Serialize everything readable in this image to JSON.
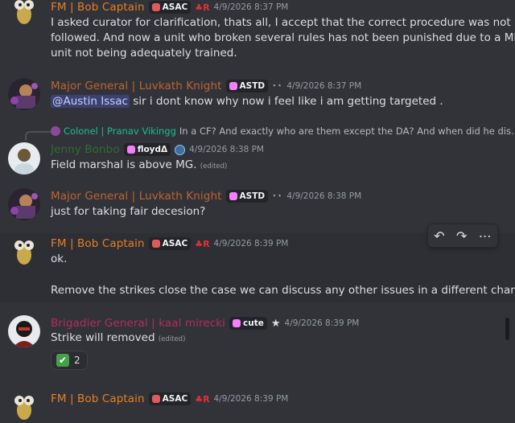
{
  "messages": [
    {
      "name": "FM | Bob Captain",
      "name_color": "#e67e22",
      "tag": "ASAC",
      "badge": "♣R",
      "timestamp": "4/9/2026 8:37 PM",
      "lines": [
        "I asked curator for clarification, thats all, I accept that the correct procedure was not",
        "followed. And now a unit who broken several rules has not been punished due to a MP",
        "unit not being adequately trained."
      ]
    },
    {
      "name": "Major General | Luvkath  Knight",
      "name_color": "#c0632f",
      "tag": "ASTD",
      "stars": "⋆⋆",
      "timestamp": "4/9/2026 8:37 PM",
      "mention": "@Austin Issac",
      "text": " sir i dont know why now i feel like i am getting  targeted ."
    },
    {
      "reply_name": "Colonel | Pranav Vikingg",
      "reply_text": "In a CF? And exactly who are them except the DA? And when did he dis...",
      "name": "Jenny Bonbo",
      "name_color": "#2d6e2d",
      "tag": "floydΔ",
      "timestamp": "4/9/2026 8:38 PM",
      "text": "Field marshal is above MG.",
      "edited": "(edited)"
    },
    {
      "name": "Major General | Luvkath  Knight",
      "name_color": "#c0632f",
      "tag": "ASTD",
      "stars": "⋆⋆",
      "timestamp": "4/9/2026 8:38 PM",
      "text": "just for taking fair decesion?"
    },
    {
      "name": "FM | Bob Captain",
      "name_color": "#e67e22",
      "tag": "ASAC",
      "badge": "♣R",
      "timestamp": "4/9/2026 8:39 PM",
      "line1": "ok.",
      "line2": "Remove the strikes close the case we can discuss any other issues in a different channel"
    },
    {
      "name": "Brigadier General | kaal mirecki",
      "name_color": "#b02e5a",
      "tag": "cute",
      "timestamp": "4/9/2026 8:39 PM",
      "text": "Strike will removed",
      "edited": "(edited)",
      "reaction_emoji": "✔",
      "reaction_count": "2"
    },
    {
      "name": "FM | Bob Captain",
      "name_color": "#e67e22",
      "tag": "ASAC",
      "badge": "♣R",
      "timestamp": "4/9/2026 8:39 PM"
    }
  ],
  "toolbar": {
    "reply": "↶",
    "forward": "↷",
    "more": "⋯"
  },
  "colors": {
    "background": "#323339",
    "hover": "#2e2f35",
    "mention_bg": "#3c4270",
    "reply_name": "#1abc9c"
  }
}
